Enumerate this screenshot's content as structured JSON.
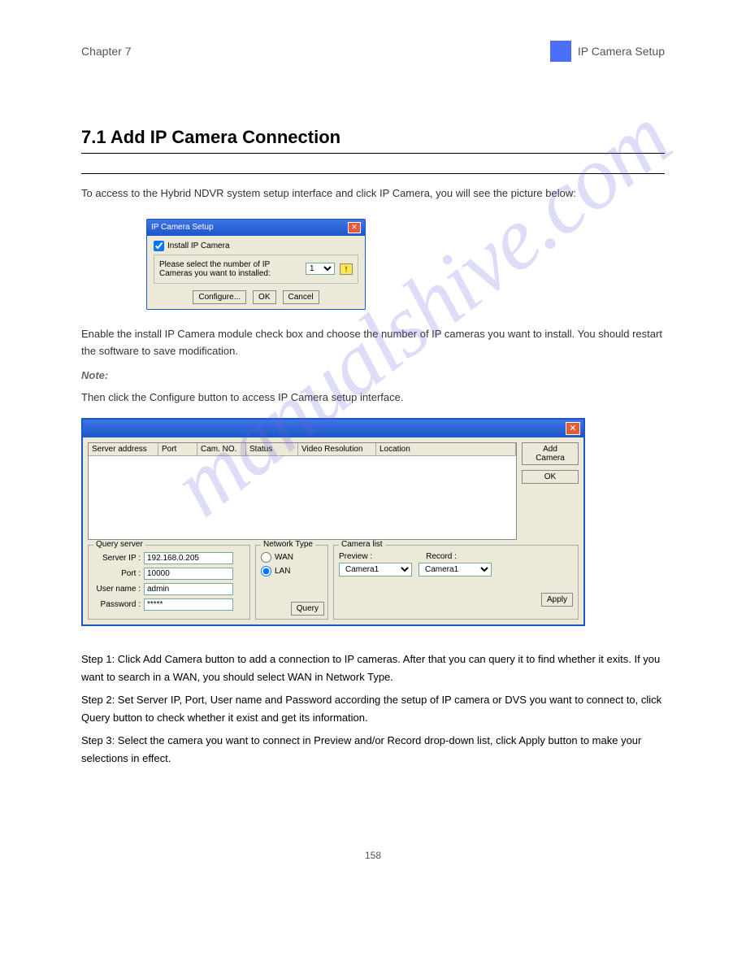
{
  "header": {
    "left": "Chapter 7",
    "right": "IP Camera Setup"
  },
  "section": {
    "title": "7.1 Add IP Camera Connection"
  },
  "intro": "To access to the Hybrid NDVR system setup interface and click IP Camera, you will see the picture below:",
  "dialog1": {
    "title": "IP Camera Setup",
    "checkbox": "Install IP Camera",
    "prompt": "Please select the number of IP Cameras you want to installed:",
    "value": "1",
    "buttons": {
      "configure": "Configure...",
      "ok": "OK",
      "cancel": "Cancel"
    }
  },
  "mid1": "Enable the install IP Camera module check box and choose the number of IP cameras you want to install. You should restart the software to save modification.",
  "note": "Note:",
  "mid2": "Then click the Configure button to access IP Camera setup interface.",
  "dialog2": {
    "headers": [
      "Server address",
      "Port",
      "Cam. NO.",
      "Status",
      "Video Resolution",
      "Location"
    ],
    "side": {
      "add": "Add Camera",
      "ok": "OK"
    },
    "query": {
      "title": "Query server",
      "server_ip_label": "Server IP :",
      "server_ip": "192.168.0.205",
      "port_label": "Port :",
      "port": "10000",
      "user_label": "User name :",
      "user": "admin",
      "pass_label": "Password :",
      "pass": "*****",
      "query_btn": "Query"
    },
    "network": {
      "title": "Network Type",
      "wan": "WAN",
      "lan": "LAN"
    },
    "camera_list": {
      "title": "Camera list",
      "preview_label": "Preview :",
      "preview": "Camera1",
      "record_label": "Record :",
      "record": "Camera1",
      "apply": "Apply"
    }
  },
  "steps": {
    "s1": "Step 1: Click Add Camera button to add a connection to IP cameras. After that you can query it to find whether it exits. If you want to search in a WAN, you should select WAN in Network Type.",
    "s2": "Step 2: Set Server IP, Port, User name and Password according the setup of IP camera or DVS you want to connect to, click Query button to check whether it exist and get its information.",
    "s3": "Step 3: Select the camera you want to connect in Preview and/or Record drop-down list, click Apply button to make your selections in effect."
  },
  "footer": "158"
}
